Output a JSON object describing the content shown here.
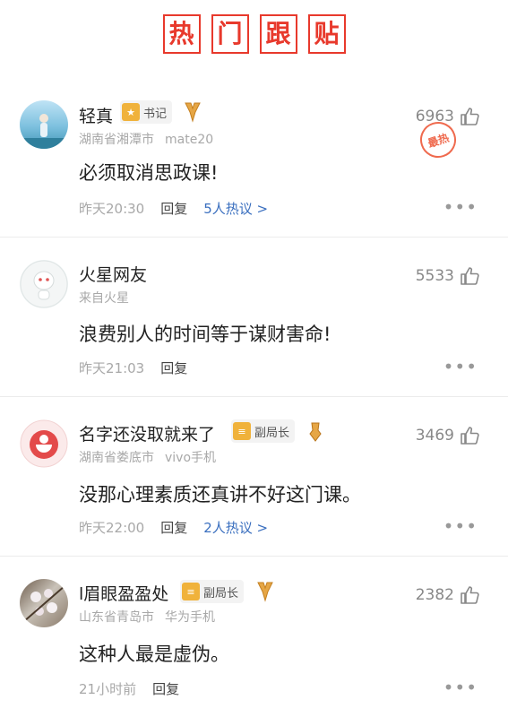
{
  "header": {
    "title_chars": [
      "热",
      "门",
      "跟",
      "贴"
    ]
  },
  "comments": [
    {
      "username": "轻真",
      "badge": "书记",
      "location": "湖南省湘潭市",
      "device": "mate20",
      "text": "必须取消思政课!",
      "time": "昨天20:30",
      "reply": "回复",
      "hot": "5人热议 >",
      "likes": "6963",
      "stamp": "最热"
    },
    {
      "username": "火星网友",
      "location": "来自火星",
      "text": "浪费别人的时间等于谋财害命!",
      "time": "昨天21:03",
      "reply": "回复",
      "likes": "5533"
    },
    {
      "username": "名字还没取就来了",
      "badge": "副局长",
      "location": "湖南省娄底市",
      "device": "vivo手机",
      "text": "没那心理素质还真讲不好这门课。",
      "time": "昨天22:00",
      "reply": "回复",
      "hot": "2人热议 >",
      "likes": "3469"
    },
    {
      "username": "l眉眼盈盈处",
      "badge": "副局长",
      "location": "山东省青岛市",
      "device": "华为手机",
      "text": "这种人最是虚伪。",
      "time": "21小时前",
      "reply": "回复",
      "likes": "2382"
    }
  ],
  "more_label": "•••",
  "colors": {
    "accent_red": "#e8392c",
    "link_blue": "#3a6fbf",
    "badge_gold": "#f0b23b"
  },
  "icons": [
    "thumbs-up-icon",
    "more-icon",
    "medal-icon",
    "badge-icon"
  ]
}
